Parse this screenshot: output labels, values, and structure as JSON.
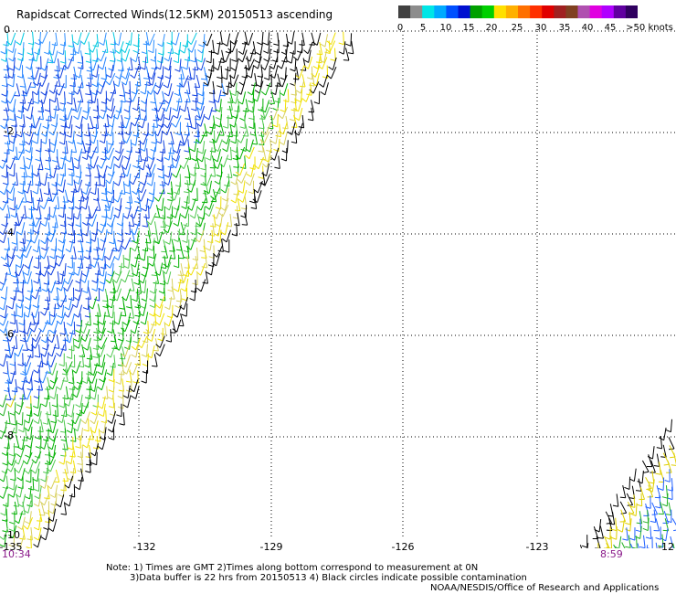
{
  "title": "Rapidscat Corrected Winds(12.5KM) 20150513 ascending",
  "colorbar": {
    "labels": [
      "0",
      "5",
      "10",
      "15",
      "20",
      "25",
      "30",
      "35",
      "40",
      "45",
      ">50 knots"
    ],
    "colors": [
      "#404040",
      "#8c8c8c",
      "#00e6e6",
      "#00aaff",
      "#0050ff",
      "#0010d0",
      "#00a000",
      "#00d000",
      "#ffe000",
      "#ffb000",
      "#ff7000",
      "#ff3000",
      "#e00000",
      "#a02020",
      "#804020",
      "#b050b0",
      "#e000e0",
      "#b000ff",
      "#6000a0",
      "#300060"
    ]
  },
  "x_axis_labels": [
    "-135",
    "-132",
    "-129",
    "-126",
    "-123",
    "-12"
  ],
  "y_axis_labels": [
    "0",
    "-2",
    "-4",
    "-6",
    "-8",
    "-10"
  ],
  "times": {
    "left": "10:34",
    "right": "8:59"
  },
  "notes": {
    "line1": "Note: 1) Times are GMT 2)Times along bottom correspond to measurement at 0N",
    "line2": "3)Data buffer is 22 hrs from 20150513 4) Black circles indicate possible contamination",
    "line3": "NOAA/NESDIS/Office of Research and Applications"
  }
}
